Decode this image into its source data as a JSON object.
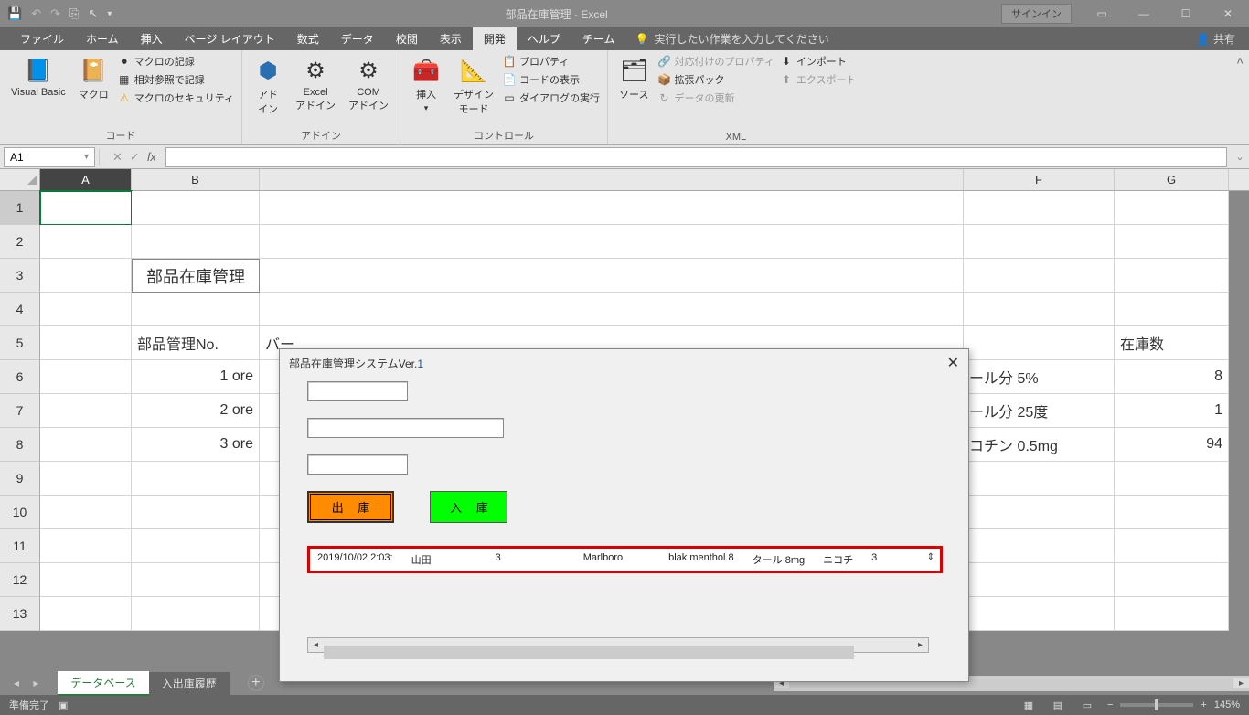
{
  "titlebar": {
    "title": "部品在庫管理 - Excel",
    "signin": "サインイン"
  },
  "tabs": {
    "file": "ファイル",
    "home": "ホーム",
    "insert": "挿入",
    "layout": "ページ レイアウト",
    "formulas": "数式",
    "data": "データ",
    "review": "校閲",
    "view": "表示",
    "developer": "開発",
    "help": "ヘルプ",
    "team": "チーム",
    "tell": "実行したい作業を入力してください",
    "share": "共有"
  },
  "ribbon": {
    "g1": {
      "vb": "Visual Basic",
      "macro": "マクロ",
      "rec": "マクロの記録",
      "rel": "相対参照で記録",
      "sec": "マクロのセキュリティ",
      "label": "コード"
    },
    "g2": {
      "addin": "アド\nイン",
      "excel": "Excel\nアドイン",
      "com": "COM\nアドイン",
      "label": "アドイン"
    },
    "g3": {
      "insert": "挿入",
      "design": "デザイン\nモード",
      "prop": "プロパティ",
      "code": "コードの表示",
      "dialog": "ダイアログの実行",
      "label": "コントロール"
    },
    "g4": {
      "source": "ソース",
      "map": "対応付けのプロパティ",
      "ext": "拡張パック",
      "refresh": "データの更新",
      "import": "インポート",
      "export": "エクスポート",
      "label": "XML"
    }
  },
  "namebox": "A1",
  "columns": [
    "A",
    "B",
    "",
    "F",
    "G"
  ],
  "sheet": {
    "title_cell": "部品在庫管理",
    "h_no": "部品管理No.",
    "h_bar": "バー",
    "h_stock": "在庫数",
    "rows": [
      {
        "no": "1",
        "ore": "ore",
        "f": "ール分 5%",
        "g": "8"
      },
      {
        "no": "2",
        "ore": "ore",
        "f": "ール分 25度",
        "g": "1"
      },
      {
        "no": "3",
        "ore": "ore",
        "f": "コチン 0.5mg",
        "g": "94"
      }
    ]
  },
  "dialog": {
    "title_a": "部品在庫管理システムVer.",
    "title_b": "1",
    "out": "出 庫",
    "in": "入 庫",
    "list": {
      "dt": "2019/10/02 2:03:",
      "name": "山田",
      "qty": "3",
      "brand": "Marlboro",
      "kind": "blak menthol 8",
      "tar": "タール 8mg",
      "nic": "ニコチ",
      "n2": "3"
    }
  },
  "sheets": {
    "s1": "データベース",
    "s2": "入出庫履歴"
  },
  "status": {
    "ready": "準備完了",
    "zoom": "145%"
  }
}
